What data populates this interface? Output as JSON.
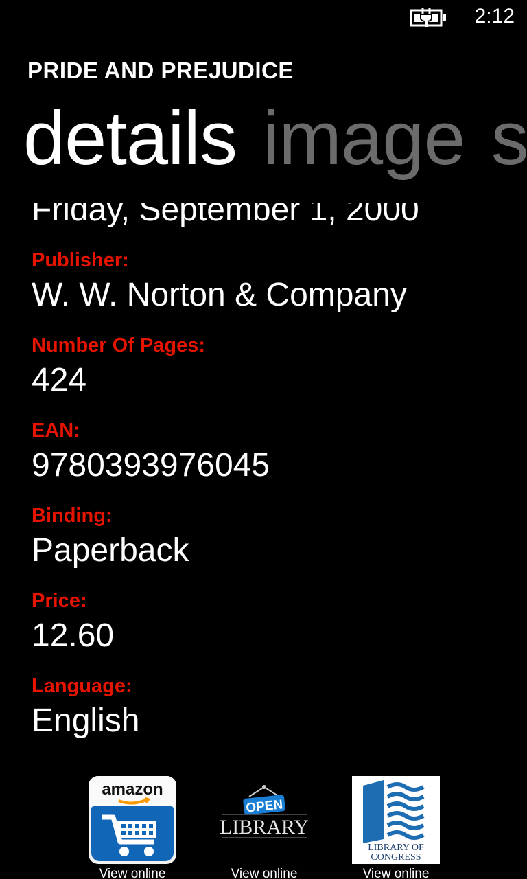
{
  "status": {
    "time": "2:12",
    "battery_icon": "battery-charging-icon"
  },
  "app": {
    "title": "PRIDE AND PREJUDICE"
  },
  "pivot": {
    "items": [
      "details",
      "image",
      "s"
    ]
  },
  "details": {
    "partial_value": "Friday, September 1, 2000",
    "fields": [
      {
        "label": "Publisher:",
        "value": "W. W. Norton & Company"
      },
      {
        "label": "Number Of Pages:",
        "value": "424"
      },
      {
        "label": "EAN:",
        "value": "9780393976045"
      },
      {
        "label": "Binding:",
        "value": "Paperback"
      },
      {
        "label": "Price:",
        "value": "12.60"
      },
      {
        "label": "Language:",
        "value": "English"
      }
    ]
  },
  "links": [
    {
      "name": "amazon",
      "logo_text": "amazon",
      "caption": "View online"
    },
    {
      "name": "open-library",
      "logo_top": "OPEN",
      "logo_bottom": "LIBRARY",
      "caption": "View online"
    },
    {
      "name": "library-of-congress",
      "logo_line1": "LIBRARY OF",
      "logo_line2": "CONGRESS",
      "caption": "View online"
    }
  ],
  "colors": {
    "accent": "#e51400",
    "background": "#000000",
    "inactive_pivot": "#6b6b6b"
  }
}
